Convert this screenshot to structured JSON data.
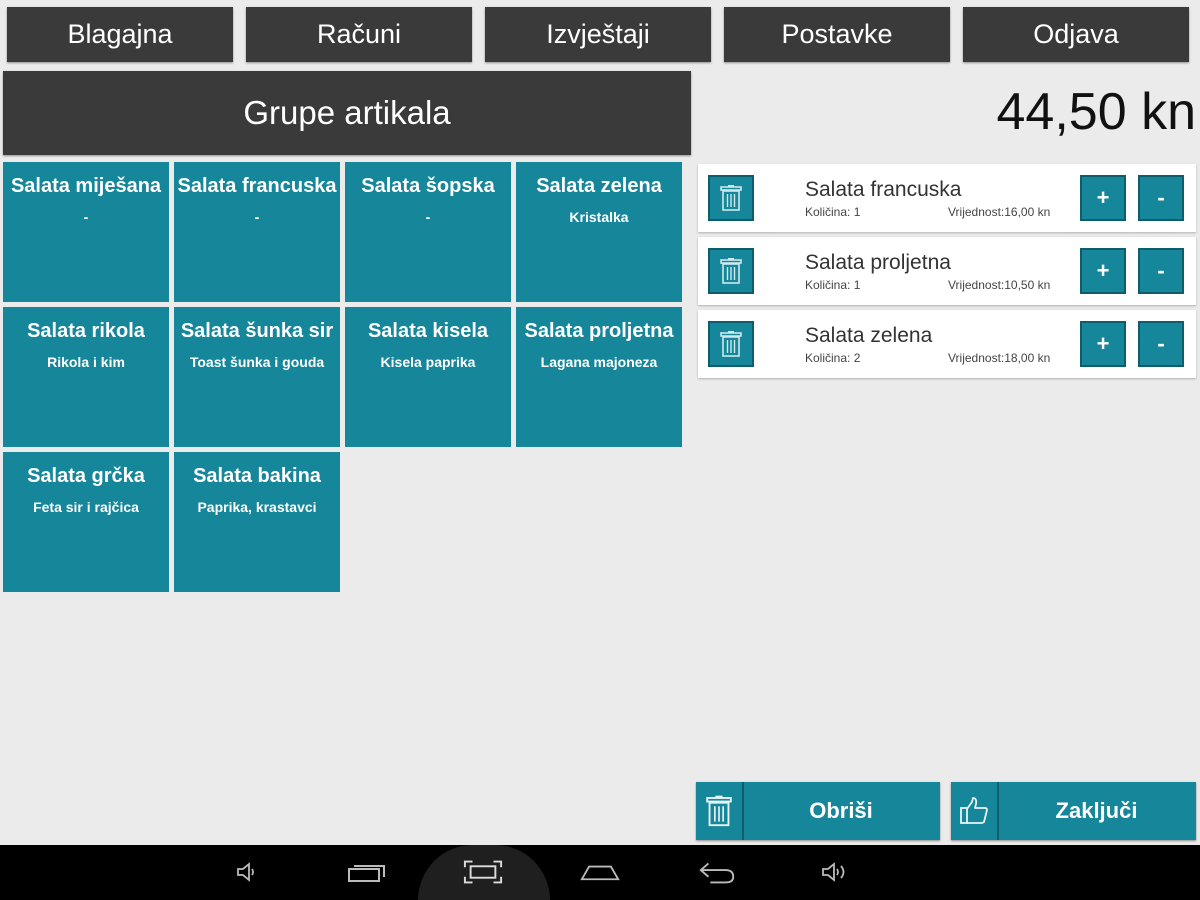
{
  "nav": {
    "cash_register": "Blagajna",
    "invoices": "Računi",
    "reports": "Izvještaji",
    "settings": "Postavke",
    "logout": "Odjava"
  },
  "groups_button": "Grupe artikala",
  "total": "44,50 kn",
  "products": [
    {
      "name": "Salata miješana",
      "desc": "-"
    },
    {
      "name": "Salata francuska",
      "desc": "-"
    },
    {
      "name": "Salata šopska",
      "desc": "-"
    },
    {
      "name": "Salata zelena",
      "desc": "Kristalka"
    },
    {
      "name": "Salata rikola",
      "desc": "Rikola i kim"
    },
    {
      "name": "Salata šunka sir",
      "desc": "Toast šunka i gouda"
    },
    {
      "name": "Salata kisela",
      "desc": "Kisela paprika"
    },
    {
      "name": "Salata proljetna",
      "desc": "Lagana majoneza"
    },
    {
      "name": "Salata grčka",
      "desc": "Feta sir i rajčica"
    },
    {
      "name": "Salata bakina",
      "desc": "Paprika, krastavci"
    }
  ],
  "order": [
    {
      "name": "Salata francuska",
      "qty": "Količina: 1",
      "value": "Vrijednost:16,00 kn"
    },
    {
      "name": "Salata proljetna",
      "qty": "Količina: 1",
      "value": "Vrijednost:10,50 kn"
    },
    {
      "name": "Salata zelena",
      "qty": "Količina: 2",
      "value": "Vrijednost:18,00 kn"
    }
  ],
  "plus_label": "+",
  "minus_label": "-",
  "delete_label": "Obriši",
  "finish_label": "Zaključi",
  "colors": {
    "accent": "#16869a",
    "dark": "#3a3a3a",
    "background": "#ebebeb"
  },
  "icons": [
    "trash-icon",
    "thumbs-up-icon",
    "volume-down-icon",
    "recent-apps-icon",
    "screenshot-icon",
    "home-icon",
    "back-icon",
    "volume-up-icon"
  ]
}
